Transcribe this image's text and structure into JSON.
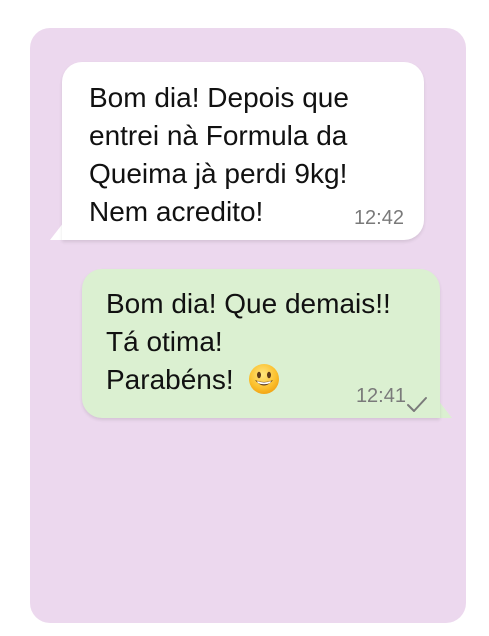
{
  "colors": {
    "chat_background": "#ecd8ee",
    "incoming_bubble": "#ffffff",
    "outgoing_bubble": "#dbf0d1",
    "timestamp": "#7a7a7a"
  },
  "messages": [
    {
      "direction": "incoming",
      "text": "Bom dia! Depois que\nentrei nà Formula da\nQueima jà perdi 9kg!\nNem acredito!",
      "time": "12:42"
    },
    {
      "direction": "outgoing",
      "text": "Bom dia! Que demais!!\nTá otima!\nParabéns!",
      "emoji": "smiling-face-icon",
      "time": "12:41",
      "status_icon": "check-icon"
    }
  ]
}
